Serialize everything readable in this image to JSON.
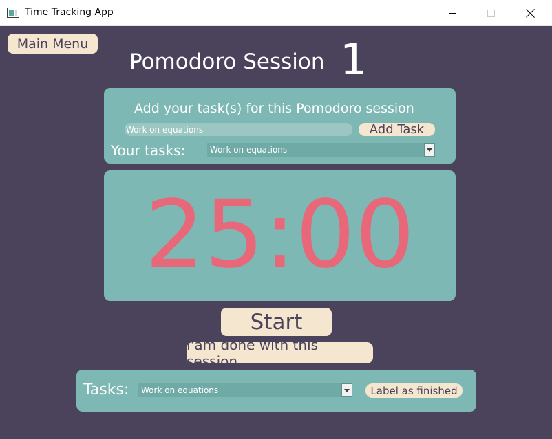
{
  "window": {
    "title": "Time Tracking App"
  },
  "header": {
    "main_menu_label": "Main Menu",
    "session_title": "Pomodoro Session",
    "session_number": "1"
  },
  "add_panel": {
    "heading": "Add your task(s) for this Pomodoro session",
    "task_input_value": "Work on equations",
    "add_task_label": "Add Task",
    "your_tasks_label": "Your tasks:",
    "your_tasks_selected": "Work on equations"
  },
  "timer": {
    "display": "25:00"
  },
  "controls": {
    "start_label": "Start",
    "done_label": "I'am done with this session"
  },
  "tasks_panel": {
    "label": "Tasks:",
    "selected": "Work on equations",
    "label_finished": "Label as finished"
  },
  "colors": {
    "background": "#4b435c",
    "panel": "#7db8b4",
    "button": "#f5e6cf",
    "timer": "#e8687a"
  }
}
